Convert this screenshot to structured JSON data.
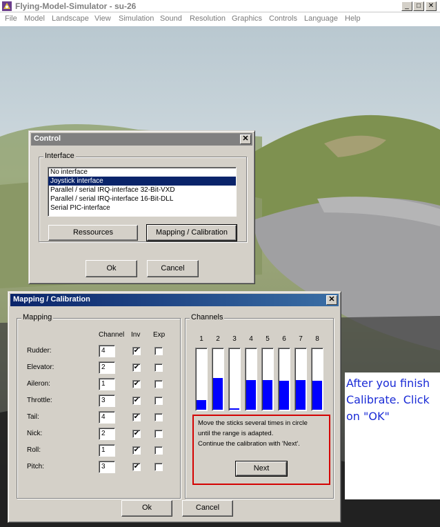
{
  "app": {
    "title": "Flying-Model-Simulator - su-26",
    "buttons": {
      "minimize": "_",
      "maximize": "□",
      "close": "✕"
    }
  },
  "menu": [
    "File",
    "Model",
    "Landscape",
    "View",
    "Simulation",
    "Sound",
    "Resolution",
    "Graphics",
    "Controls",
    "Language",
    "Help"
  ],
  "control_dialog": {
    "title": "Control",
    "close": "✕",
    "group_label": "Interface",
    "interfaces": [
      "No interface",
      "Joystick interface",
      "Parallel / serial IRQ-interface 32-Bit-VXD",
      "Parallel / serial IRQ-interface 16-Bit-DLL",
      "Serial PIC-interface"
    ],
    "selected_index": 1,
    "resources_button": "Ressources",
    "mapping_button": "Mapping / Calibration",
    "ok_button": "Ok",
    "cancel_button": "Cancel"
  },
  "mapping_dialog": {
    "title": "Mapping / Calibration",
    "close": "✕",
    "mapping_group": "Mapping",
    "headers": {
      "channel": "Channel",
      "inv": "Inv",
      "exp": "Exp"
    },
    "rows": [
      {
        "label": "Rudder:",
        "channel": "4",
        "inv": true,
        "exp": false
      },
      {
        "label": "Elevator:",
        "channel": "2",
        "inv": true,
        "exp": false
      },
      {
        "label": "Aileron:",
        "channel": "1",
        "inv": true,
        "exp": false
      },
      {
        "label": "Throttle:",
        "channel": "3",
        "inv": true,
        "exp": false
      },
      {
        "label": "Tail:",
        "channel": "4",
        "inv": true,
        "exp": false
      },
      {
        "label": "Nick:",
        "channel": "2",
        "inv": true,
        "exp": false
      },
      {
        "label": "Roll:",
        "channel": "1",
        "inv": true,
        "exp": false
      },
      {
        "label": "Pitch:",
        "channel": "3",
        "inv": true,
        "exp": false
      }
    ],
    "channels_group": "Channels",
    "channels": [
      {
        "label": "1",
        "level": 0.16
      },
      {
        "label": "2",
        "level": 0.52
      },
      {
        "label": "3",
        "level": 0.02
      },
      {
        "label": "4",
        "level": 0.49
      },
      {
        "label": "5",
        "level": 0.49
      },
      {
        "label": "6",
        "level": 0.48
      },
      {
        "label": "7",
        "level": 0.49
      },
      {
        "label": "8",
        "level": 0.48
      }
    ],
    "instructions": [
      "Move the sticks several times in circle",
      "until the range is adapted.",
      "Continue the calibration with 'Next'."
    ],
    "next_button": "Next",
    "ok_button": "Ok",
    "cancel_button": "Cancel"
  },
  "annotation": {
    "lines": [
      "After you finish",
      "Calibrate. Click",
      "on \"OK\""
    ]
  }
}
